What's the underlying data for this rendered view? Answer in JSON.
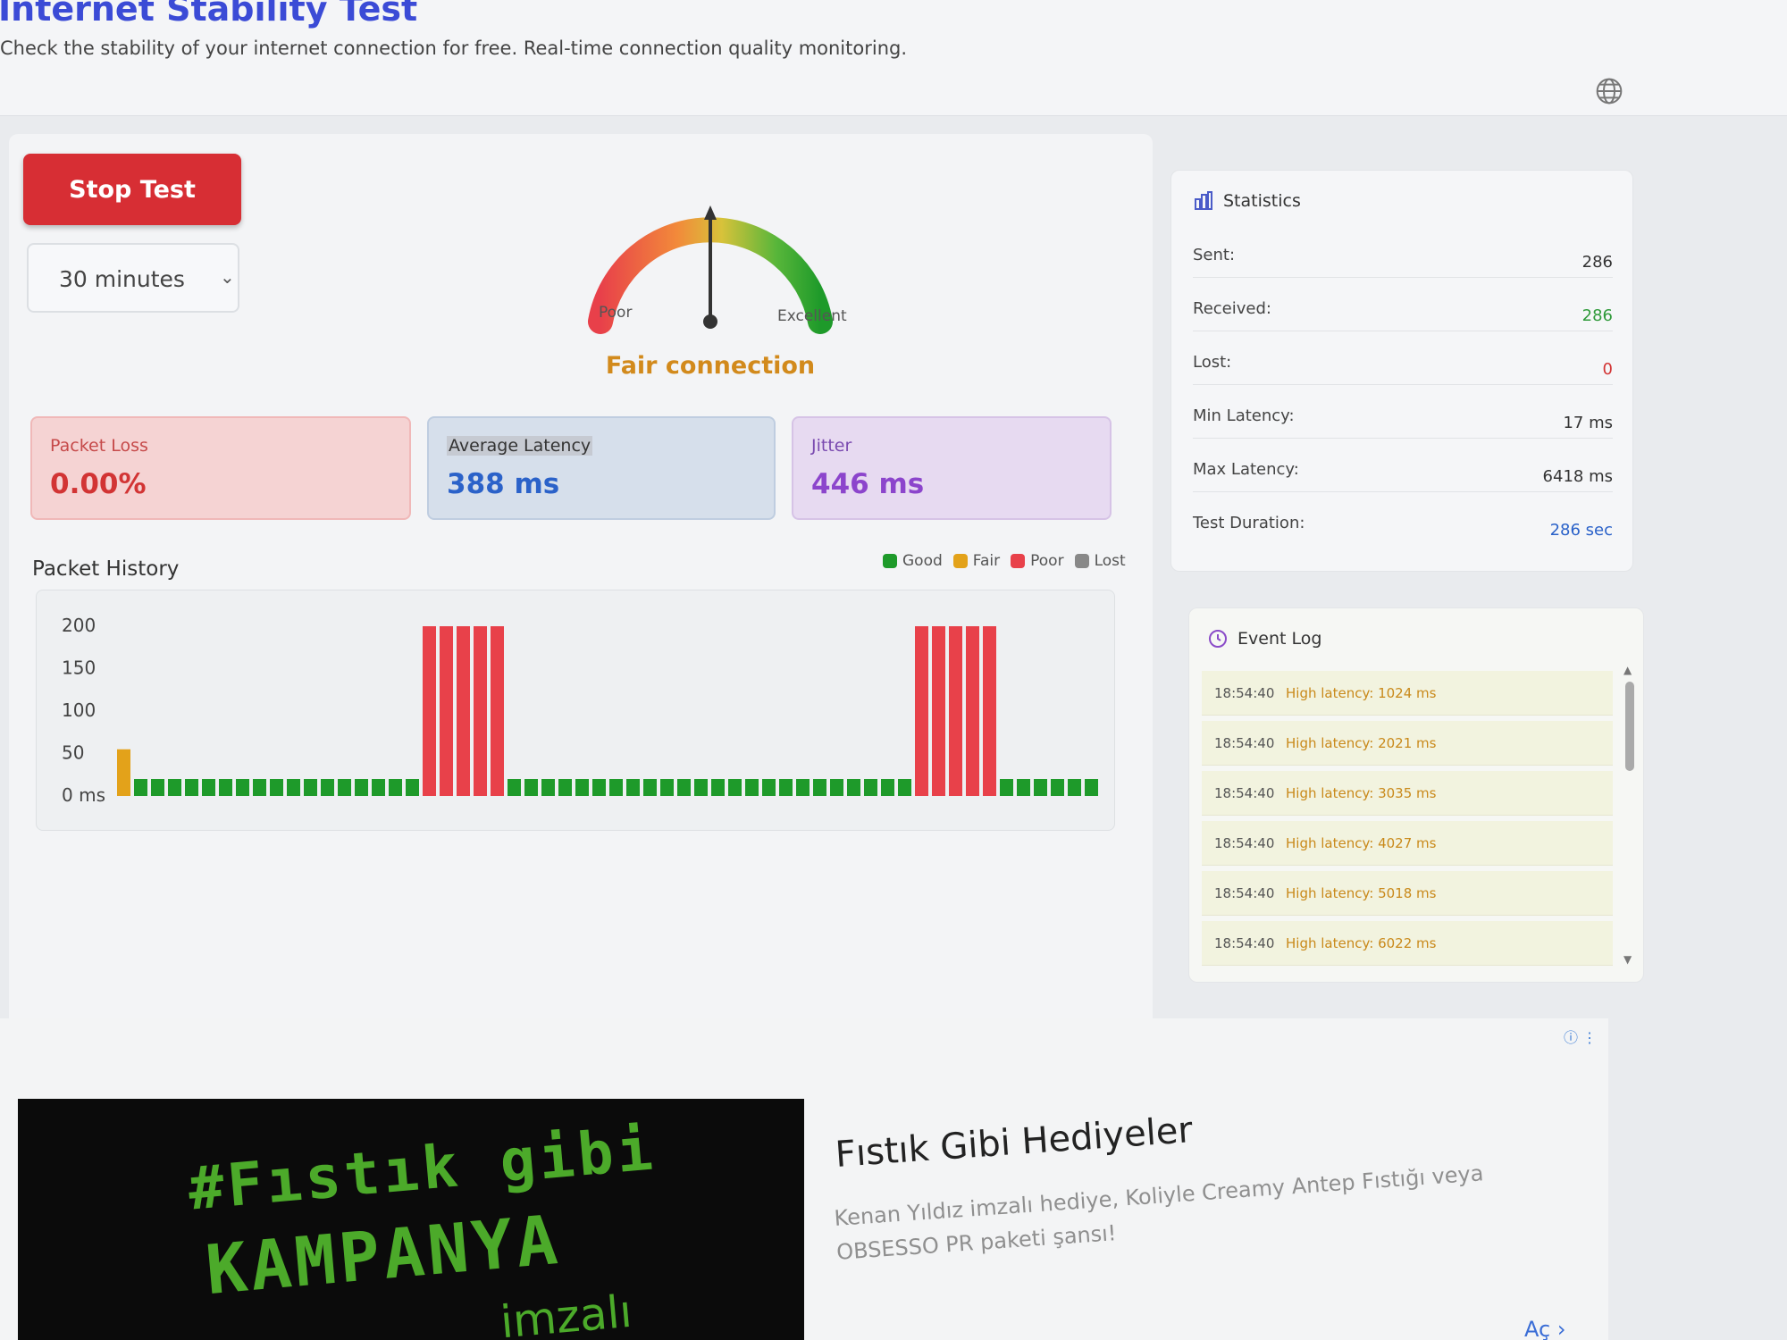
{
  "header": {
    "title": "Internet Stability Test",
    "subtitle": "Check the stability of your internet connection for free. Real-time connection quality monitoring.",
    "language_icon": "globe-icon"
  },
  "controls": {
    "stop_label": "Stop Test",
    "duration_value": "30 minutes"
  },
  "gauge": {
    "left_label": "Poor",
    "right_label": "Excellent",
    "status": "Fair connection",
    "status_color": "#d28a1c",
    "needle_level": 0.5
  },
  "metrics": {
    "packet_loss": {
      "label": "Packet Loss",
      "value": "0.00%"
    },
    "avg_latency": {
      "label": "Average Latency",
      "value": "388 ms"
    },
    "jitter": {
      "label": "Jitter",
      "value": "446 ms"
    }
  },
  "history": {
    "title": "Packet History",
    "legend": [
      {
        "name": "Good",
        "color": "#1e9a2a"
      },
      {
        "name": "Fair",
        "color": "#e3a21a"
      },
      {
        "name": "Poor",
        "color": "#e8414a"
      },
      {
        "name": "Lost",
        "color": "#888888"
      }
    ]
  },
  "chart_data": {
    "type": "bar",
    "title": "Packet History",
    "y_ticks": [
      "200",
      "150",
      "100",
      "50",
      "0 ms"
    ],
    "ylim": [
      0,
      200
    ],
    "series": [
      {
        "name": "Fair",
        "values": [
          55
        ]
      },
      {
        "name": "Good",
        "values": [
          20,
          20,
          20,
          20,
          20,
          20,
          20,
          20,
          20,
          20,
          20,
          20,
          20,
          20,
          20,
          20,
          20
        ]
      },
      {
        "name": "Poor",
        "values": [
          200,
          200,
          200,
          200,
          200
        ]
      },
      {
        "name": "Good",
        "values": [
          20,
          20,
          20,
          20,
          20,
          20,
          20,
          20,
          20,
          20,
          20,
          20,
          20,
          20,
          20,
          20,
          20,
          20,
          20,
          20,
          20,
          20,
          20,
          20
        ]
      },
      {
        "name": "Poor",
        "values": [
          200,
          200,
          200,
          200,
          200
        ]
      },
      {
        "name": "Good",
        "values": [
          20,
          20,
          20,
          20,
          20,
          20
        ]
      }
    ],
    "colors": {
      "Good": "#1e9a2a",
      "Fair": "#e3a21a",
      "Poor": "#e8414a"
    }
  },
  "stats": {
    "title": "Statistics",
    "rows": [
      {
        "label": "Sent:",
        "value": "286",
        "color": "#333333"
      },
      {
        "label": "Received:",
        "value": "286",
        "color": "#2f9a3a"
      },
      {
        "label": "Lost:",
        "value": "0",
        "color": "#d23434"
      },
      {
        "label": "Min Latency:",
        "value": "17 ms",
        "color": "#333333"
      },
      {
        "label": "Max Latency:",
        "value": "6418 ms",
        "color": "#333333"
      },
      {
        "label": "Test Duration:",
        "value": "286 sec",
        "color": "#2b62c9"
      }
    ]
  },
  "event_log": {
    "title": "Event Log",
    "entries": [
      {
        "time": "18:54:40",
        "message": "High latency: 1024 ms"
      },
      {
        "time": "18:54:40",
        "message": "High latency: 2021 ms"
      },
      {
        "time": "18:54:40",
        "message": "High latency: 3035 ms"
      },
      {
        "time": "18:54:40",
        "message": "High latency: 4027 ms"
      },
      {
        "time": "18:54:40",
        "message": "High latency: 5018 ms"
      },
      {
        "time": "18:54:40",
        "message": "High latency: 6022 ms"
      }
    ]
  },
  "ad": {
    "image_line1": "#Fıstık gibi",
    "image_line2": "KAMPANYA",
    "image_line3": "imzalı",
    "title": "Fıstık Gibi Hediyeler",
    "description": "Kenan Yıldız imzalı hediye, Koliyle Creamy Antep Fıstığı veya OBSESSO PR paketi şansı!",
    "cta": "Aç",
    "cta_icon": "chevron-right-icon",
    "info_icon": "info-icon"
  }
}
